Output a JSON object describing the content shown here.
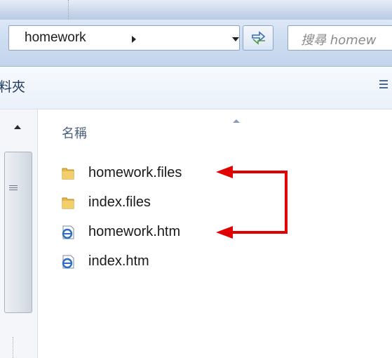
{
  "address_bar": {
    "path_segment": "homework",
    "search_placeholder": "搜尋 homew"
  },
  "toolbar": {
    "folder_label_fragment": "料夾"
  },
  "file_list": {
    "column_header_name": "名稱",
    "items": [
      {
        "name": "homework.files",
        "icon": "folder-icon"
      },
      {
        "name": "index.files",
        "icon": "folder-icon"
      },
      {
        "name": "homework.htm",
        "icon": "ie-html-file-icon"
      },
      {
        "name": "index.htm",
        "icon": "ie-html-file-icon"
      }
    ]
  },
  "annotation": {
    "color": "#e00000",
    "arrow_targets": [
      "homework.files",
      "homework.htm"
    ]
  },
  "colors": {
    "frame": "#c9d7ea",
    "address_border": "#8ea4c6",
    "toolbar_text": "#1e395b",
    "folder_yellow": "#e8b84a"
  }
}
